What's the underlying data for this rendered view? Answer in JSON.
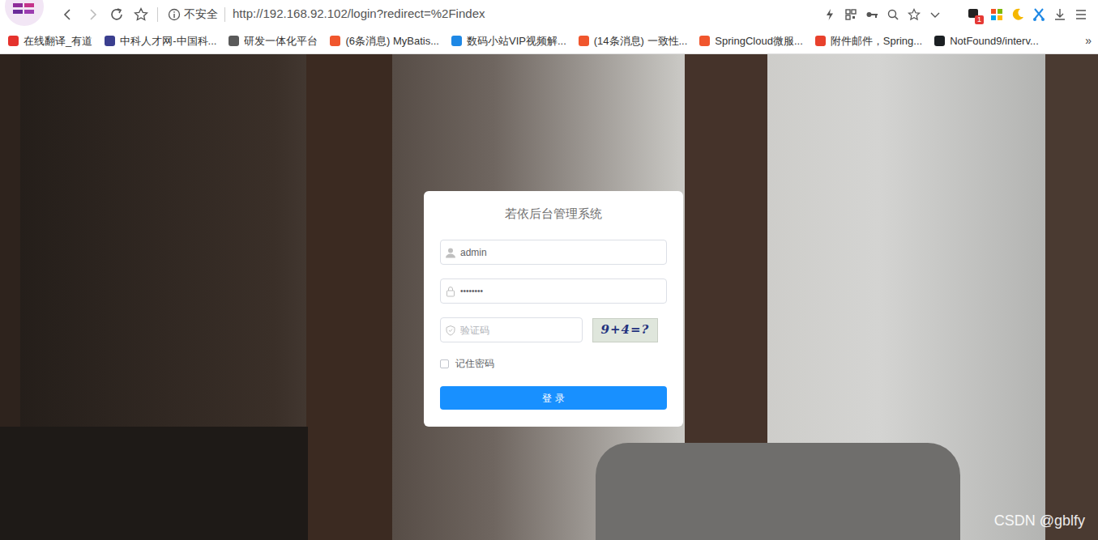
{
  "browser": {
    "security_label": "不安全",
    "url": "http://192.168.92.102/login?redirect=%2Findex",
    "extension_badge": "1",
    "bookmarks": [
      {
        "label": "在线翻译_有道",
        "color": "#e5322d"
      },
      {
        "label": "中科人才网-中国科...",
        "color": "#3b3f8f"
      },
      {
        "label": "研发一体化平台",
        "color": "#5a5a5a"
      },
      {
        "label": "(6条消息) MyBatis...",
        "color": "#f0562d"
      },
      {
        "label": "数码小站VIP视频解...",
        "color": "#1e88e5"
      },
      {
        "label": "(14条消息) 一致性...",
        "color": "#f0562d"
      },
      {
        "label": "SpringCloud微服...",
        "color": "#f0562d"
      },
      {
        "label": "附件邮件，Spring...",
        "color": "#e8412c"
      },
      {
        "label": "NotFound9/interv...",
        "color": "#1b1f23"
      }
    ],
    "bookmarks_more": "»"
  },
  "page": {
    "title": "若依后台管理系统",
    "username": {
      "value": "admin"
    },
    "password": {
      "value": "••••••••"
    },
    "captcha": {
      "placeholder": "验证码",
      "image_text": "9+4=?"
    },
    "remember": {
      "label": "记住密码",
      "checked": false
    },
    "login_button": "登 录",
    "watermark": "CSDN @gblfy"
  }
}
